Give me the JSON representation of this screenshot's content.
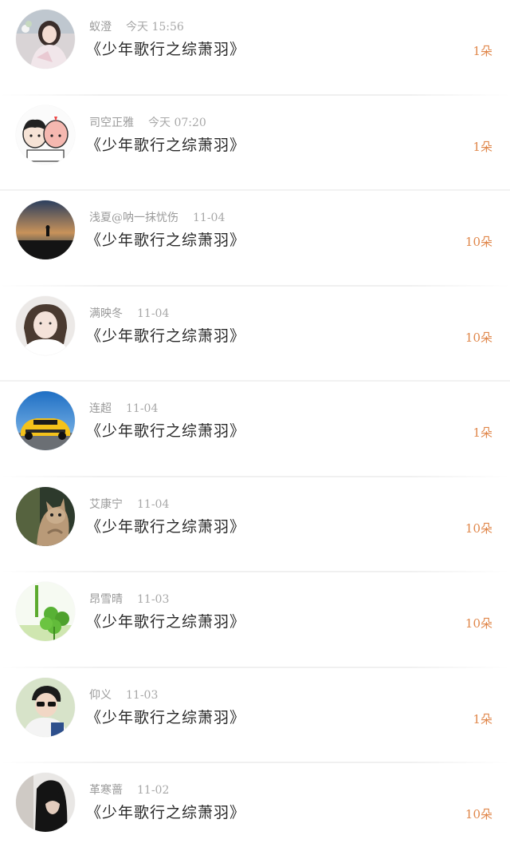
{
  "items": [
    {
      "user": "蚁澄",
      "time": "今天 15:56",
      "title": "《少年歌行之综萧羽》",
      "count": "1朵",
      "avatar": "girl-photo-avatar"
    },
    {
      "user": "司空正雅",
      "time": "今天 07:20",
      "title": "《少年歌行之综萧羽》",
      "count": "1朵",
      "avatar": "cartoon-couple-avatar"
    },
    {
      "user": "浅夏@呐一抹忧伤",
      "time": "11-04",
      "title": "《少年歌行之综萧羽》",
      "count": "10朵",
      "avatar": "sunset-silhouette-avatar"
    },
    {
      "user": "满映冬",
      "time": "11-04",
      "title": "《少年歌行之综萧羽》",
      "count": "10朵",
      "avatar": "girl-portrait-avatar"
    },
    {
      "user": "连超",
      "time": "11-04",
      "title": "《少年歌行之综萧羽》",
      "count": "1朵",
      "avatar": "yellow-car-avatar"
    },
    {
      "user": "艾康宁",
      "time": "11-04",
      "title": "《少年歌行之综萧羽》",
      "count": "10朵",
      "avatar": "kitten-avatar"
    },
    {
      "user": "昂雪晴",
      "time": "11-03",
      "title": "《少年歌行之综萧羽》",
      "count": "10朵",
      "avatar": "clover-avatar"
    },
    {
      "user": "仰义",
      "time": "11-03",
      "title": "《少年歌行之综萧羽》",
      "count": "1朵",
      "avatar": "boy-sunglasses-avatar"
    },
    {
      "user": "革寒蔷",
      "time": "11-02",
      "title": "《少年歌行之综萧羽》",
      "count": "10朵",
      "avatar": "dark-portrait-avatar"
    }
  ],
  "colors": {
    "count": "#e0874b",
    "meta": "#9a9a9a",
    "title": "#2a2a2a"
  }
}
